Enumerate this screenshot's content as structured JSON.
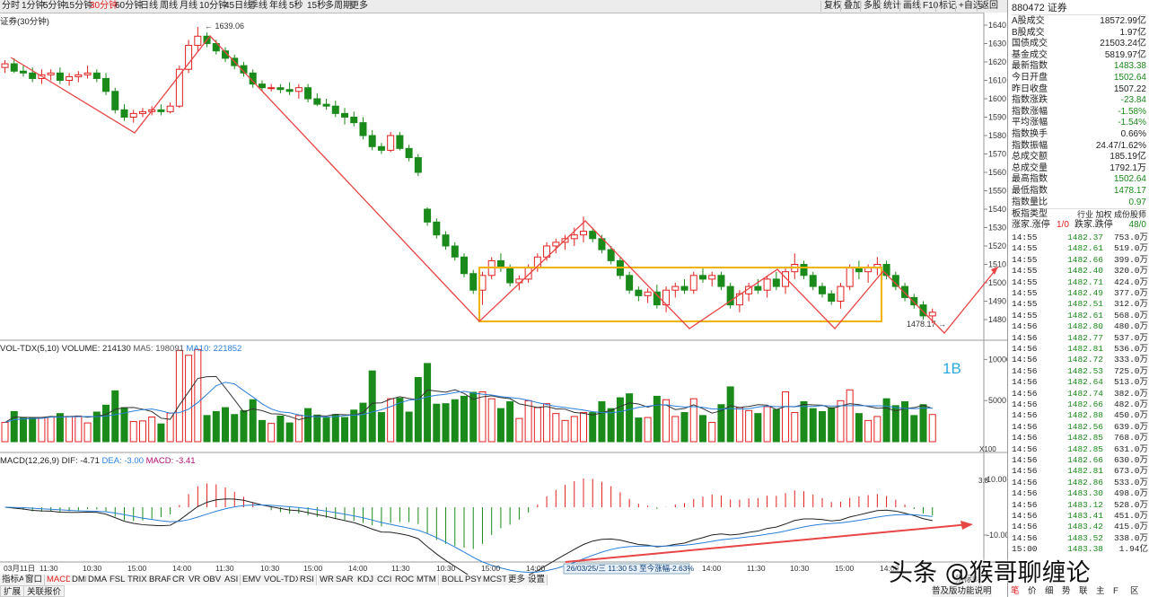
{
  "toolbar": {
    "periods": [
      "分时",
      "1分钟",
      "5分钟",
      "15分钟",
      "30分钟",
      "60分钟",
      "日线",
      "周线",
      "月线",
      "10分钟",
      "45日线",
      "季线",
      "年线",
      "5秒",
      "15秒",
      "多周期",
      "更多"
    ],
    "active": "30分钟",
    "right": [
      "复权",
      "叠加",
      "多股",
      "统计",
      "画线",
      "F10",
      "标记",
      "+自选",
      "返回"
    ]
  },
  "chart_title": "证券(30分钟)",
  "price_axis": [
    "1640",
    "1630",
    "1620",
    "1610",
    "1600",
    "1590",
    "1580",
    "1570",
    "1560",
    "1550",
    "1540",
    "1530",
    "1520",
    "1510",
    "1500",
    "1490",
    "1480"
  ],
  "annotations": {
    "high": "1639.06",
    "low": "1478.17",
    "box_label": "1B"
  },
  "vol_header": {
    "name": "VOL-TDX(5,10)",
    "volume": "VOLUME: 214130",
    "ma5": "MA5: 198091",
    "ma10": "MA10: 221852"
  },
  "vol_axis": [
    "10000",
    "5000"
  ],
  "vol_unit": "X100",
  "macd_header": {
    "name": "MACD(12,26,9)",
    "dif": "DIF: -4.71",
    "dea": "DEA: -3.00",
    "macd": "MACD: -3.41"
  },
  "macd_axis": [
    "10.00",
    "-10.00"
  ],
  "macd_tag": "3.8",
  "time_axis": [
    "03月11日",
    "11:30",
    "10:30",
    "15:00",
    "14:00",
    "11:30",
    "10:30",
    "15:00",
    "14:00",
    "11:30",
    "10:30",
    "15:00",
    "14:00",
    "11:30",
    "10:30",
    "15:00",
    "14:00",
    "11:30",
    "10:30",
    "15:00",
    "14:00"
  ],
  "cursor_info": "26/03/25/三 11:30 53 至今涨幅-2.63%",
  "indicator_tabs": [
    "指标A",
    "窗口",
    "MACD",
    "DMI",
    "DMA",
    "FSL",
    "TRIX",
    "BRAR",
    "CR",
    "VR",
    "OBV",
    "ASI",
    "EMV",
    "VOL-TDX",
    "RSI",
    "WR",
    "SAR",
    "KDJ",
    "CCI",
    "ROC",
    "MTM",
    "BOLL",
    "PSY",
    "MCST",
    "更多",
    "设置"
  ],
  "active_tab": "MACD",
  "bottom_left": [
    "扩展",
    "关联报价"
  ],
  "bottom_right": "指标B",
  "status": {
    "notice": "普及版功能说明",
    "keys": [
      "笔",
      "价",
      "细",
      "势",
      "联",
      "主",
      "F",
      "区"
    ]
  },
  "watermark": "头条 @猴哥聊缠论",
  "side": {
    "code": "880472",
    "name": "证券",
    "rows": [
      {
        "l": "A股成交",
        "v": "18572.99亿",
        "c": "k"
      },
      {
        "l": "B股成交",
        "v": "1.97亿",
        "c": "k"
      },
      {
        "l": "国债成交",
        "v": "21503.24亿",
        "c": "k"
      },
      {
        "l": "基金成交",
        "v": "5819.97亿",
        "c": "k"
      },
      {
        "l": "最新指数",
        "v": "1483.38",
        "c": "g"
      },
      {
        "l": "今日开盘",
        "v": "1502.64",
        "c": "g"
      },
      {
        "l": "昨日收盘",
        "v": "1507.22",
        "c": "k"
      },
      {
        "l": "指数涨跌",
        "v": "-23.84",
        "c": "g"
      },
      {
        "l": "指数涨幅",
        "v": "-1.58%",
        "c": "g"
      },
      {
        "l": "平均涨幅",
        "v": "-1.54%",
        "c": "g"
      },
      {
        "l": "指数换手",
        "v": "0.66%",
        "c": "k"
      },
      {
        "l": "指数振幅",
        "v": "24.47/1.62%",
        "c": "k"
      },
      {
        "l": "总成交额",
        "v": "185.19亿",
        "c": "k"
      },
      {
        "l": "总成交量",
        "v": "1792.1万",
        "c": "k"
      },
      {
        "l": "最高指数",
        "v": "1502.64",
        "c": "g"
      },
      {
        "l": "最低指数",
        "v": "1478.17",
        "c": "g"
      },
      {
        "l": "指数量比",
        "v": "0.97",
        "c": "g"
      }
    ],
    "type_label": "板指类型",
    "type_value": "行业 加权 成份股师",
    "updown": {
      "l1": "涨家.涨停",
      "v1": "1/0",
      "l2": "跌家.跌停",
      "v2": "48/0"
    },
    "ticks": [
      [
        "14:55",
        "1482.37",
        "753.0万"
      ],
      [
        "14:55",
        "1482.61",
        "519.0万"
      ],
      [
        "14:55",
        "1482.66",
        "399.0万"
      ],
      [
        "14:55",
        "1482.40",
        "320.0万"
      ],
      [
        "14:55",
        "1482.71",
        "424.0万"
      ],
      [
        "14:55",
        "1482.49",
        "377.0万"
      ],
      [
        "14:55",
        "1482.51",
        "312.0万"
      ],
      [
        "14:55",
        "1482.61",
        "568.0万"
      ],
      [
        "14:56",
        "1482.80",
        "480.0万"
      ],
      [
        "14:56",
        "1482.77",
        "537.0万"
      ],
      [
        "14:56",
        "1482.81",
        "536.0万"
      ],
      [
        "14:56",
        "1482.72",
        "333.0万"
      ],
      [
        "14:56",
        "1482.53",
        "725.0万"
      ],
      [
        "14:56",
        "1482.64",
        "513.0万"
      ],
      [
        "14:56",
        "1482.74",
        "382.0万"
      ],
      [
        "14:56",
        "1482.66",
        "482.0万"
      ],
      [
        "14:56",
        "1482.88",
        "450.0万"
      ],
      [
        "14:56",
        "1482.56",
        "639.0万"
      ],
      [
        "14:56",
        "1482.85",
        "768.0万"
      ],
      [
        "14:56",
        "1482.85",
        "631.0万"
      ],
      [
        "14:56",
        "1482.66",
        "630.0万"
      ],
      [
        "14:56",
        "1482.81",
        "673.0万"
      ],
      [
        "14:56",
        "1482.86",
        "533.0万"
      ],
      [
        "14:56",
        "1483.30",
        "498.0万"
      ],
      [
        "14:56",
        "1483.12",
        "528.0万"
      ],
      [
        "14:56",
        "1483.41",
        "451.0万"
      ],
      [
        "14:56",
        "1483.42",
        "415.0万"
      ],
      [
        "14:56",
        "1483.52",
        "338.0万"
      ],
      [
        "15:00",
        "1483.38",
        "1.94亿"
      ]
    ]
  },
  "chart_data": {
    "type": "candlestick",
    "title": "证券(30分钟)",
    "ylim": [
      1475,
      1645
    ],
    "ohlc": [
      [
        1617,
        1621,
        1614,
        1619
      ],
      [
        1619,
        1622,
        1614,
        1615
      ],
      [
        1615,
        1618,
        1612,
        1614
      ],
      [
        1614,
        1617,
        1609,
        1611
      ],
      [
        1611,
        1616,
        1608,
        1613
      ],
      [
        1613,
        1616,
        1610,
        1614
      ],
      [
        1614,
        1617,
        1608,
        1610
      ],
      [
        1610,
        1614,
        1607,
        1612
      ],
      [
        1612,
        1615,
        1609,
        1613
      ],
      [
        1613,
        1618,
        1611,
        1614
      ],
      [
        1614,
        1616,
        1609,
        1611
      ],
      [
        1611,
        1614,
        1602,
        1604
      ],
      [
        1604,
        1606,
        1592,
        1594
      ],
      [
        1594,
        1597,
        1588,
        1590
      ],
      [
        1590,
        1594,
        1587,
        1592
      ],
      [
        1592,
        1595,
        1590,
        1593
      ],
      [
        1593,
        1596,
        1591,
        1594
      ],
      [
        1594,
        1597,
        1591,
        1593
      ],
      [
        1593,
        1598,
        1592,
        1596
      ],
      [
        1596,
        1618,
        1595,
        1616
      ],
      [
        1616,
        1632,
        1614,
        1629
      ],
      [
        1629,
        1639,
        1626,
        1634
      ],
      [
        1634,
        1636,
        1628,
        1630
      ],
      [
        1630,
        1632,
        1624,
        1626
      ],
      [
        1626,
        1628,
        1620,
        1622
      ],
      [
        1622,
        1624,
        1616,
        1618
      ],
      [
        1618,
        1620,
        1612,
        1614
      ],
      [
        1614,
        1616,
        1606,
        1608
      ],
      [
        1608,
        1610,
        1604,
        1606
      ],
      [
        1606,
        1608,
        1604,
        1606
      ],
      [
        1606,
        1608,
        1603,
        1605
      ],
      [
        1605,
        1609,
        1602,
        1604
      ],
      [
        1604,
        1608,
        1600,
        1606
      ],
      [
        1606,
        1608,
        1598,
        1600
      ],
      [
        1600,
        1603,
        1596,
        1597
      ],
      [
        1597,
        1600,
        1594,
        1596
      ],
      [
        1596,
        1599,
        1590,
        1592
      ],
      [
        1592,
        1595,
        1586,
        1590
      ],
      [
        1590,
        1593,
        1585,
        1587
      ],
      [
        1587,
        1590,
        1578,
        1580
      ],
      [
        1580,
        1583,
        1572,
        1574
      ],
      [
        1574,
        1576,
        1570,
        1572
      ],
      [
        1572,
        1582,
        1571,
        1580
      ],
      [
        1580,
        1582,
        1572,
        1573
      ],
      [
        1573,
        1575,
        1566,
        1568
      ],
      [
        1568,
        1570,
        1558,
        1560
      ],
      [
        1540,
        1541,
        1531,
        1533
      ],
      [
        1533,
        1535,
        1524,
        1526
      ],
      [
        1526,
        1528,
        1518,
        1520
      ],
      [
        1520,
        1522,
        1512,
        1514
      ],
      [
        1514,
        1516,
        1503,
        1505
      ],
      [
        1505,
        1507,
        1494,
        1496
      ],
      [
        1496,
        1506,
        1488,
        1504
      ],
      [
        1504,
        1514,
        1502,
        1512
      ],
      [
        1512,
        1516,
        1506,
        1508
      ],
      [
        1508,
        1510,
        1498,
        1500
      ],
      [
        1500,
        1504,
        1496,
        1502
      ],
      [
        1502,
        1510,
        1500,
        1508
      ],
      [
        1508,
        1516,
        1506,
        1514
      ],
      [
        1514,
        1522,
        1512,
        1520
      ],
      [
        1520,
        1524,
        1516,
        1522
      ],
      [
        1522,
        1526,
        1518,
        1524
      ],
      [
        1524,
        1530,
        1520,
        1526
      ],
      [
        1526,
        1536,
        1522,
        1528
      ],
      [
        1528,
        1530,
        1522,
        1524
      ],
      [
        1524,
        1526,
        1516,
        1518
      ],
      [
        1518,
        1520,
        1510,
        1512
      ],
      [
        1512,
        1514,
        1502,
        1504
      ],
      [
        1504,
        1506,
        1494,
        1496
      ],
      [
        1496,
        1498,
        1490,
        1493
      ],
      [
        1493,
        1497,
        1489,
        1495
      ],
      [
        1495,
        1499,
        1486,
        1488
      ],
      [
        1488,
        1498,
        1484,
        1496
      ],
      [
        1496,
        1500,
        1492,
        1498
      ],
      [
        1498,
        1502,
        1494,
        1496
      ],
      [
        1496,
        1506,
        1494,
        1504
      ],
      [
        1504,
        1508,
        1500,
        1502
      ],
      [
        1502,
        1506,
        1498,
        1504
      ],
      [
        1504,
        1506,
        1496,
        1498
      ],
      [
        1498,
        1500,
        1486,
        1488
      ],
      [
        1488,
        1496,
        1484,
        1494
      ],
      [
        1494,
        1500,
        1490,
        1498
      ],
      [
        1498,
        1502,
        1494,
        1496
      ],
      [
        1496,
        1504,
        1492,
        1502
      ],
      [
        1502,
        1506,
        1496,
        1498
      ],
      [
        1498,
        1508,
        1494,
        1506
      ],
      [
        1506,
        1516,
        1502,
        1510
      ],
      [
        1510,
        1512,
        1502,
        1504
      ],
      [
        1504,
        1506,
        1496,
        1498
      ],
      [
        1498,
        1500,
        1492,
        1494
      ],
      [
        1494,
        1496,
        1488,
        1490
      ],
      [
        1490,
        1500,
        1486,
        1498
      ],
      [
        1498,
        1510,
        1496,
        1508
      ],
      [
        1508,
        1512,
        1502,
        1506
      ],
      [
        1506,
        1510,
        1500,
        1508
      ],
      [
        1508,
        1514,
        1504,
        1510
      ],
      [
        1510,
        1512,
        1502,
        1504
      ],
      [
        1504,
        1506,
        1496,
        1498
      ],
      [
        1498,
        1500,
        1490,
        1492
      ],
      [
        1492,
        1494,
        1486,
        1488
      ],
      [
        1488,
        1490,
        1480,
        1482
      ],
      [
        1482,
        1486,
        1478,
        1484
      ]
    ],
    "volume_axis": [
      0,
      12000
    ],
    "macd_axis": [
      -25,
      15
    ]
  }
}
